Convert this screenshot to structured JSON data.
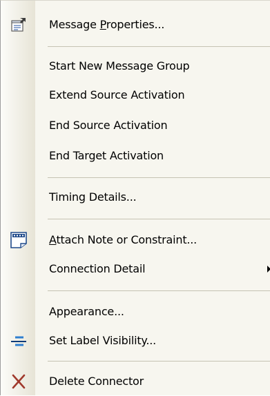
{
  "menu": {
    "items": [
      {
        "label_before": "Message ",
        "mnemonic": "P",
        "label_after": "roperties...",
        "icon": "message-properties-icon"
      },
      {
        "label": "Start New Message Group"
      },
      {
        "label": "Extend Source Activation"
      },
      {
        "label": "End Source Activation"
      },
      {
        "label": "End Target Activation"
      },
      {
        "label": "Timing Details..."
      },
      {
        "mnemonic": "A",
        "label_after": "ttach Note or Constraint...",
        "icon": "note-icon"
      },
      {
        "label": "Connection Detail",
        "submenu": "submenu-arrow-icon"
      },
      {
        "label": "Appearance..."
      },
      {
        "label": "Set Label Visibility...",
        "icon": "label-visibility-icon"
      },
      {
        "label": "Delete Connector",
        "icon": "delete-icon"
      }
    ]
  },
  "colors": {
    "menu_background": "#f7f6ef",
    "separator": "#c5c2b2",
    "delete_icon": "#a0392c",
    "label_icon": "#2f7fd0"
  }
}
